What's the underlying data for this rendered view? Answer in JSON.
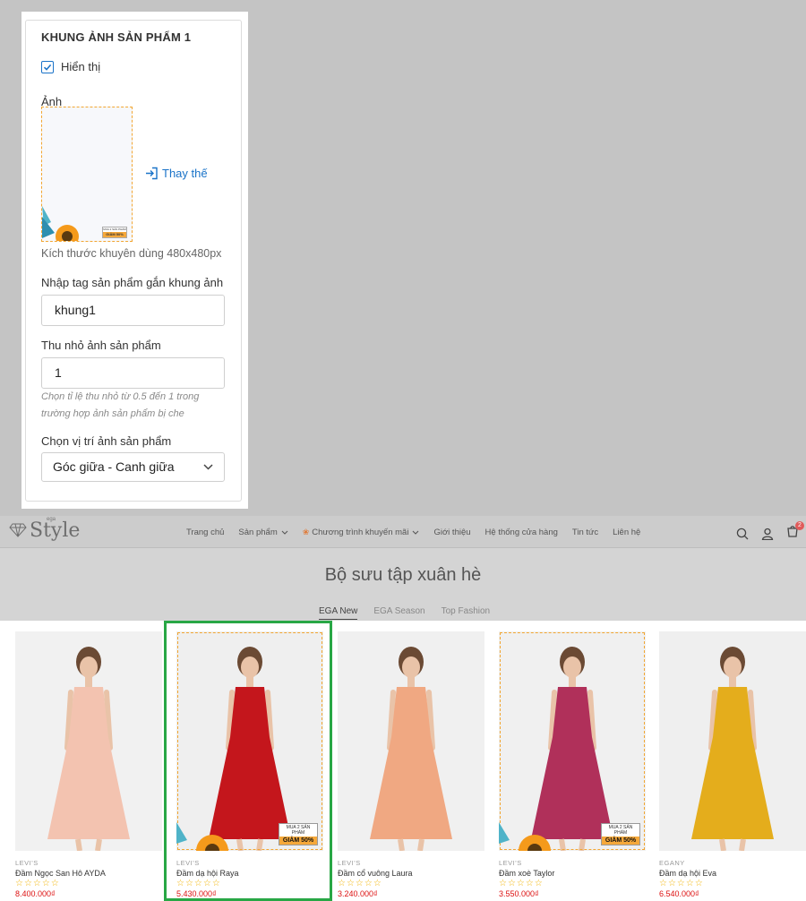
{
  "panel": {
    "title": "KHUNG ẢNH SẢN PHẨM 1",
    "show_label": "Hiển thị",
    "show_checked": true,
    "image_label": "Ảnh",
    "frame_preview": {
      "badge_top": "MUA 2 SẢN PHẨM",
      "badge_bottom": "GIẢM 50%"
    },
    "replace_label": "Thay thế",
    "size_hint": "Kích thước khuyên dùng 480x480px",
    "tag_label": "Nhập tag sản phẩm gắn khung ảnh",
    "tag_value": "khung1",
    "shrink_label": "Thu nhỏ ảnh sản phẩm",
    "shrink_value": "1",
    "shrink_help": "Chọn tỉ lệ thu nhỏ từ 0.5 đến 1 trong trường hợp ảnh sản phẩm bị che",
    "position_label": "Chọn vị trí ảnh sản phẩm",
    "position_value": "Góc giữa - Canh giữa"
  },
  "store": {
    "logo": {
      "text": "Style",
      "sub": "ega"
    },
    "nav": [
      {
        "label": "Trang chủ",
        "dropdown": false
      },
      {
        "label": "Sản phẩm",
        "dropdown": true
      },
      {
        "label": "Chương trình khuyến mãi",
        "dropdown": true
      },
      {
        "label": "Giới thiệu",
        "dropdown": false
      },
      {
        "label": "Hệ thống cửa hàng",
        "dropdown": false
      },
      {
        "label": "Tin tức",
        "dropdown": false
      },
      {
        "label": "Liên hệ",
        "dropdown": false
      }
    ],
    "cart_count": "2",
    "collection_title": "Bộ sưu tập xuân hè",
    "tabs": [
      "EGA New",
      "EGA Season",
      "Top Fashion"
    ],
    "active_tab": 0
  },
  "products": [
    {
      "brand": "LEVI'S",
      "name": "Đầm Ngọc San Hô AYDA",
      "price": "8.400.000₫",
      "dress_color": "#f3c3b0",
      "bg": "#f1f1f1",
      "framed": false
    },
    {
      "brand": "LEVI'S",
      "name": "Đầm dạ hội Raya",
      "price": "5.430.000₫",
      "dress_color": "#c4161c",
      "bg": "#efefef",
      "framed": true
    },
    {
      "brand": "LEVI'S",
      "name": "Đầm cổ vuông Laura",
      "price": "3.240.000₫",
      "dress_color": "#f0a882",
      "bg": "#f0f0f0",
      "framed": false
    },
    {
      "brand": "LEVI'S",
      "name": "Đầm xoè Taylor",
      "price": "3.550.000₫",
      "dress_color": "#b0305a",
      "bg": "#f0f0f0",
      "framed": true
    },
    {
      "brand": "EGANY",
      "name": "Đầm dạ hội Eva",
      "price": "6.540.000₫",
      "dress_color": "#e4ad1c",
      "bg": "#efefef",
      "framed": false
    }
  ],
  "frame_badge": {
    "top": "MUA 2 SẢN PHẨM",
    "bottom": "GIẢM 50%"
  },
  "colors": {
    "accent": "#1a73c8",
    "frame": "#f2a632",
    "highlight": "#28a745",
    "price": "#dd1111"
  }
}
